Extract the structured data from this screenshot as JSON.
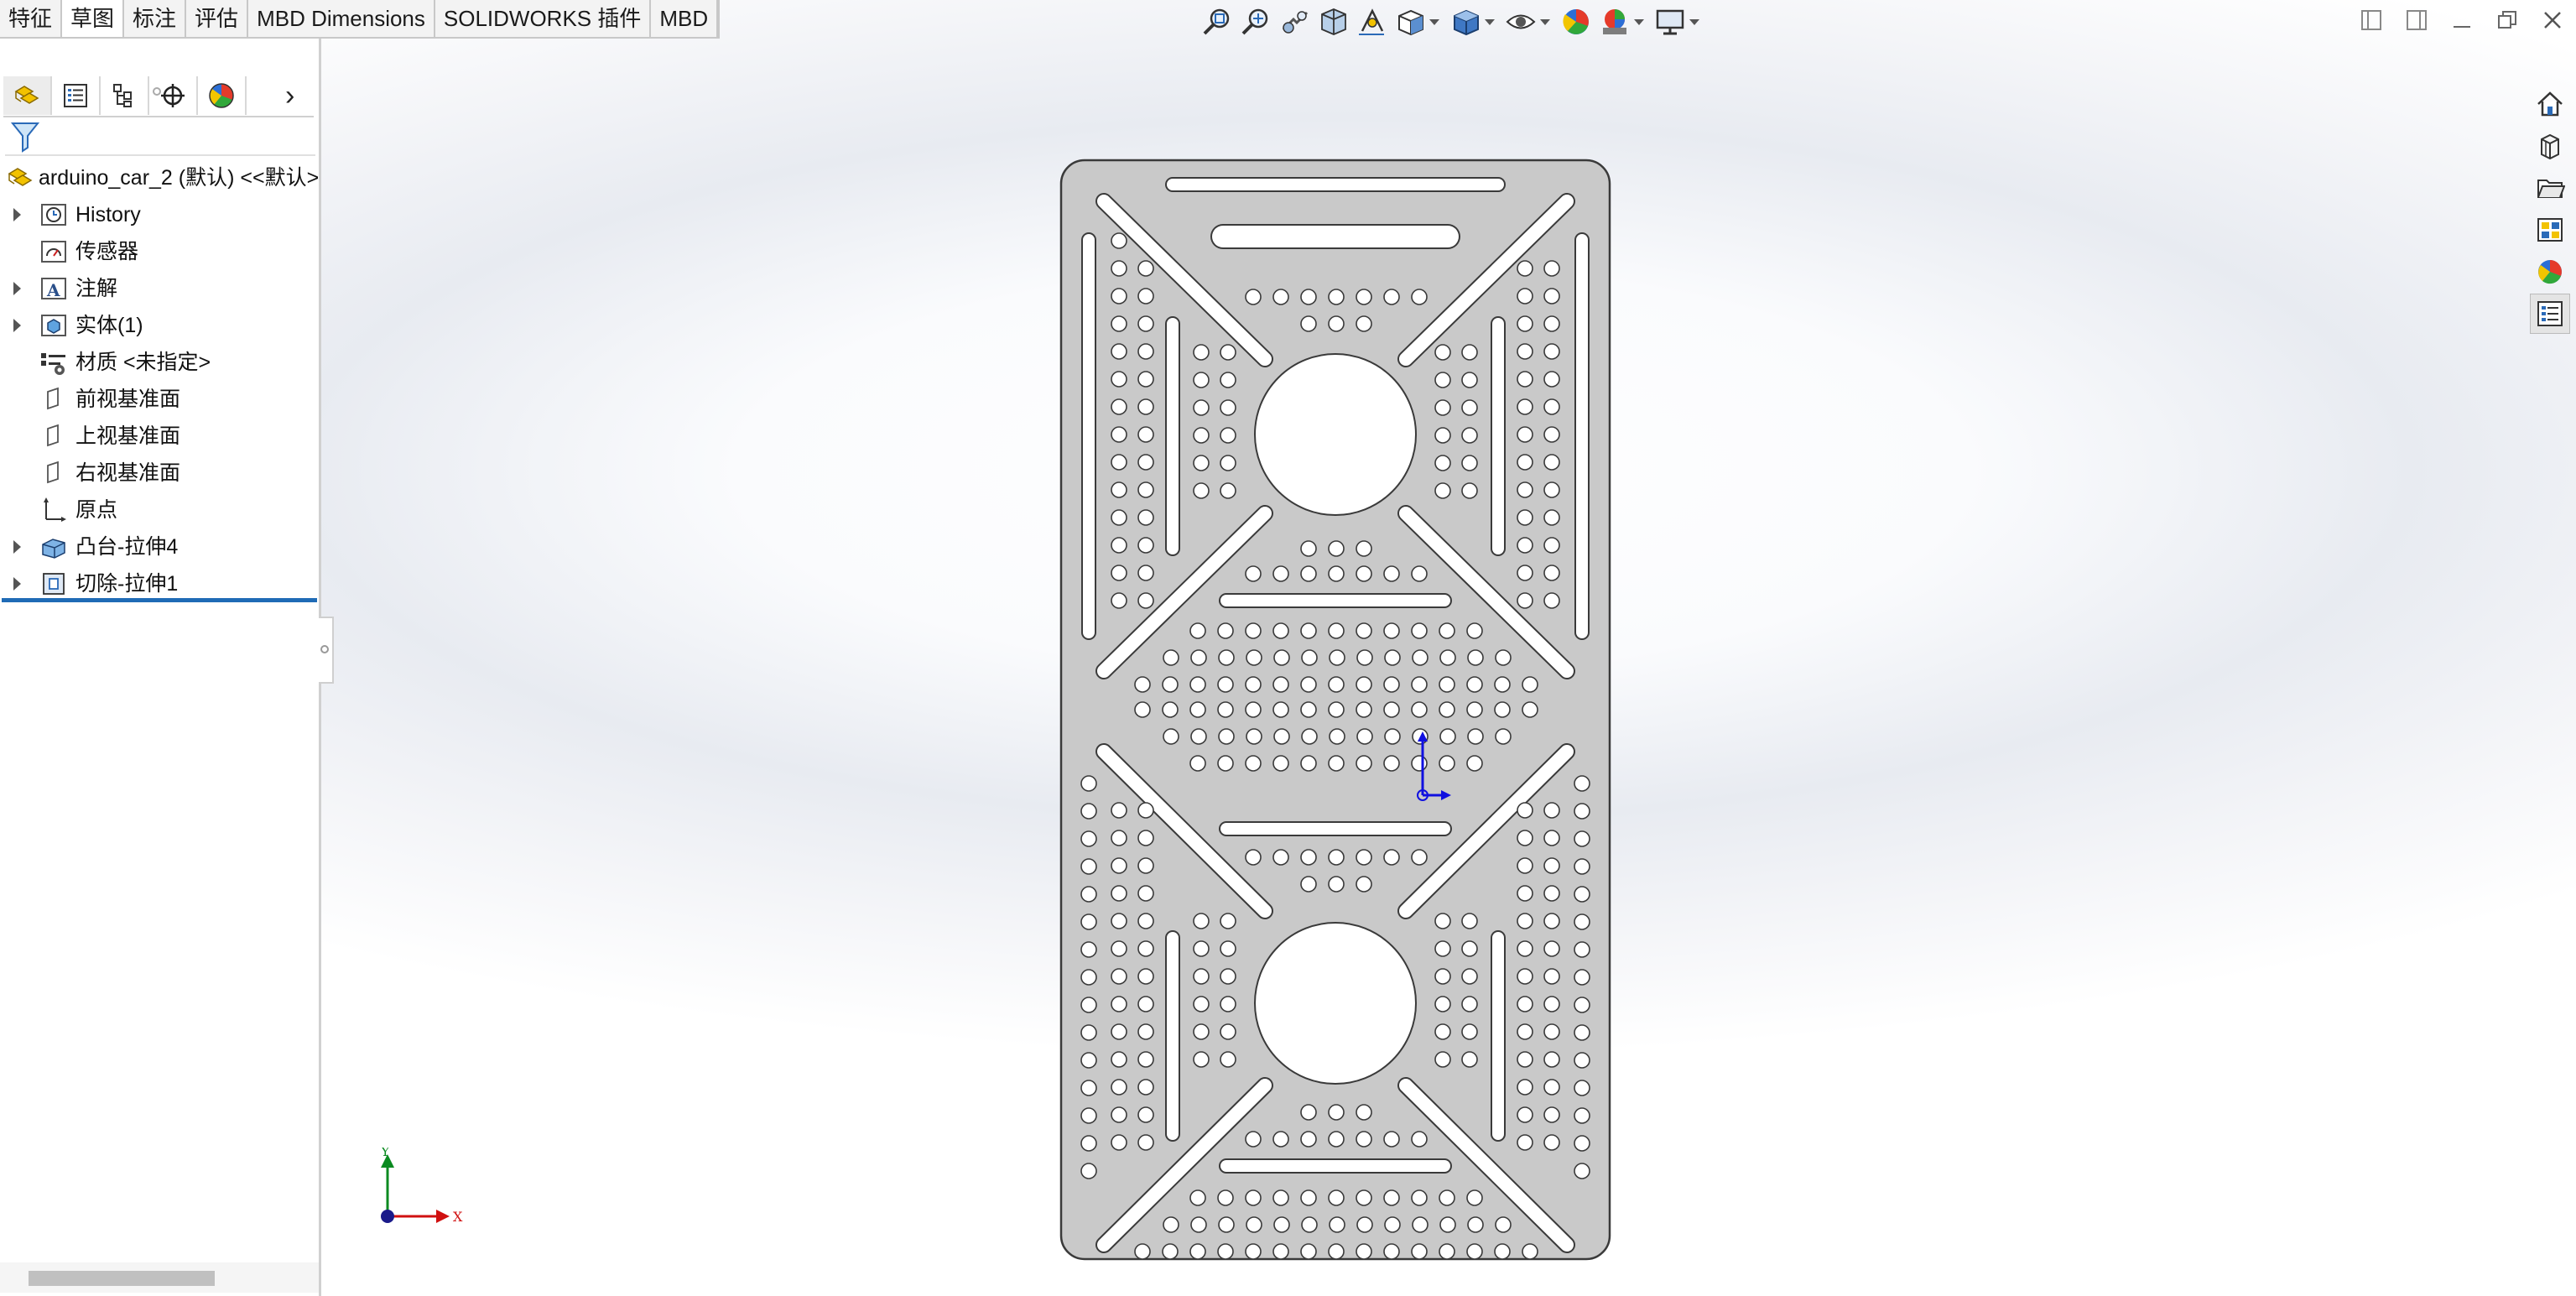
{
  "command_tabs": [
    {
      "label": "特征",
      "active": false
    },
    {
      "label": "草图",
      "active": true
    },
    {
      "label": "标注",
      "active": false
    },
    {
      "label": "评估",
      "active": false
    },
    {
      "label": "MBD Dimensions",
      "active": false
    },
    {
      "label": "SOLIDWORKS 插件",
      "active": false
    },
    {
      "label": "MBD",
      "active": false
    }
  ],
  "feature_manager": {
    "tabs": [
      "feature-manager-icon",
      "property-manager-icon",
      "configuration-manager-icon",
      "dimxpert-icon",
      "display-manager-icon"
    ],
    "root": "arduino_car_2 (默认) <<默认>",
    "items": [
      {
        "label": "History",
        "icon": "history-folder-icon",
        "expandable": true
      },
      {
        "label": "传感器",
        "icon": "sensors-folder-icon",
        "expandable": false
      },
      {
        "label": "注解",
        "icon": "annotations-icon",
        "expandable": true
      },
      {
        "label": "实体(1)",
        "icon": "solid-bodies-icon",
        "expandable": true
      },
      {
        "label": "材质 <未指定>",
        "icon": "material-icon",
        "expandable": false
      },
      {
        "label": "前视基准面",
        "icon": "plane-icon",
        "expandable": false
      },
      {
        "label": "上视基准面",
        "icon": "plane-icon",
        "expandable": false
      },
      {
        "label": "右视基准面",
        "icon": "plane-icon",
        "expandable": false
      },
      {
        "label": "原点",
        "icon": "origin-icon",
        "expandable": false
      },
      {
        "label": "凸台-拉伸4",
        "icon": "boss-extrude-icon",
        "expandable": true
      },
      {
        "label": "切除-拉伸1",
        "icon": "cut-extrude-icon",
        "expandable": true
      }
    ]
  },
  "heads_up_toolbar": [
    "zoom-to-fit-icon",
    "zoom-to-area-icon",
    "previous-view-icon",
    "section-view-icon",
    "dynamic-annotation-icon",
    "view-orientation-icon",
    "display-style-icon",
    "hide-show-icon",
    "edit-appearance-icon",
    "apply-scene-icon",
    "view-settings-icon"
  ],
  "task_pane": [
    "home-icon",
    "design-library-icon",
    "file-explorer-icon",
    "view-palette-icon",
    "appearances-icon",
    "custom-properties-icon"
  ],
  "triad": {
    "x_label": "X",
    "y_label": "Y"
  },
  "colors": {
    "part_fill": "#c9c9c9",
    "part_edge": "#3a3a3a",
    "x_axis": "#d01010",
    "y_axis": "#0a8a20",
    "z_dot": "#1a1a8a",
    "sketch_origin": "#1010e0"
  }
}
